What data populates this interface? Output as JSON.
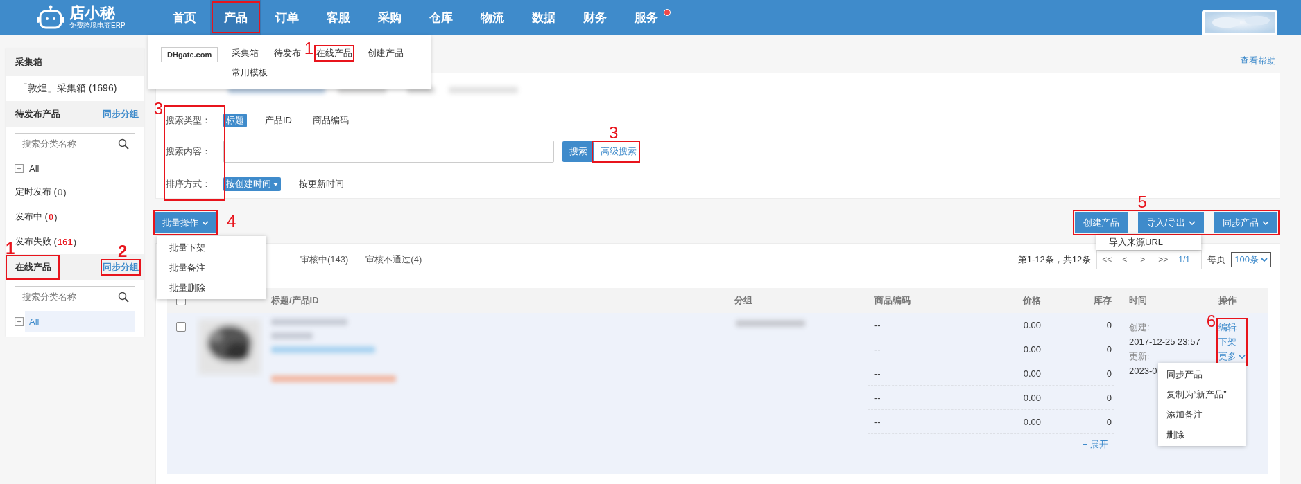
{
  "header": {
    "logo": {
      "name": "店小秘",
      "tagline": "免费跨境电商ERP"
    },
    "nav": [
      {
        "label": "首页",
        "selected": false,
        "boxed": false,
        "dot": false
      },
      {
        "label": "产品",
        "selected": true,
        "boxed": true,
        "dot": false
      },
      {
        "label": "订单",
        "selected": false,
        "boxed": false,
        "dot": false
      },
      {
        "label": "客服",
        "selected": false,
        "boxed": false,
        "dot": false
      },
      {
        "label": "采购",
        "selected": false,
        "boxed": false,
        "dot": false
      },
      {
        "label": "仓库",
        "selected": false,
        "boxed": false,
        "dot": false
      },
      {
        "label": "物流",
        "selected": false,
        "boxed": false,
        "dot": false
      },
      {
        "label": "数据",
        "selected": false,
        "boxed": false,
        "dot": false
      },
      {
        "label": "财务",
        "selected": false,
        "boxed": false,
        "dot": false
      },
      {
        "label": "服务",
        "selected": false,
        "boxed": false,
        "dot": true
      }
    ]
  },
  "product_menu": {
    "logo": "DHgate.com",
    "items": [
      {
        "label": "采集箱"
      },
      {
        "label": "待发布"
      },
      {
        "label": "在线产品",
        "boxed": true,
        "callout": "1"
      },
      {
        "label": "创建产品"
      },
      {
        "label": "常用模板"
      }
    ]
  },
  "sidebar": {
    "sections": [
      {
        "title": "采集箱",
        "entries": [
          "「敦煌」采集箱 (1696)"
        ]
      },
      {
        "title": "待发布产品",
        "action": "同步分组",
        "search_placeholder": "搜索分类名称",
        "tree": [
          {
            "label": "All",
            "selected": false
          }
        ],
        "items": [
          {
            "text": "定时发布 (**0**)",
            "alert": false
          },
          {
            "text": "发布中 (**0**)",
            "alert": true
          },
          {
            "text": "发布失败 (**161**)",
            "alert": true
          }
        ]
      },
      {
        "title": "在线产品",
        "title_boxed": true,
        "title_callout": "1",
        "action": "同步分组",
        "action_boxed": true,
        "action_callout": "2",
        "search_placeholder": "搜索分类名称",
        "tree": [
          {
            "label": "All",
            "selected": true
          }
        ]
      }
    ]
  },
  "help": "查看帮助",
  "filters": {
    "labels_boxed": true,
    "labels_callout": "3",
    "search_type": {
      "label": "搜索类型：",
      "options": [
        {
          "label": "标题",
          "selected": true
        },
        {
          "label": "产品ID",
          "selected": false
        },
        {
          "label": "商品编码",
          "selected": false
        }
      ]
    },
    "search_content": {
      "label": "搜索内容：",
      "button": "搜索",
      "advanced": "高级搜索",
      "advanced_boxed": true,
      "advanced_callout": "3"
    },
    "sort": {
      "label": "排序方式：",
      "options": [
        {
          "label": "按创建时间",
          "selected": true
        },
        {
          "label": "按更新时间",
          "selected": false
        }
      ]
    }
  },
  "batch": {
    "label": "批量操作",
    "boxed": true,
    "callout": "4",
    "open": true,
    "menu": [
      "批量下架",
      "批量备注",
      "批量删除"
    ]
  },
  "toolbar": {
    "boxed": true,
    "callout": "5",
    "buttons": [
      {
        "label": "创建产品",
        "kind": "plain"
      },
      {
        "label": "导入/导出",
        "kind": "dropdown",
        "open": true,
        "menu": [
          "导入来源URL"
        ]
      },
      {
        "label": "同步产品",
        "kind": "dropdown"
      }
    ]
  },
  "tabs": [
    {
      "label": "审核中(143)",
      "selected": false
    },
    {
      "label": "审核不通过(4)",
      "selected": false
    }
  ],
  "pagination": {
    "summary": "第1-12条，共12条",
    "buttons": [
      "<<",
      "<",
      ">",
      ">>"
    ],
    "page": "1/1",
    "per_page_label": "每页",
    "per_page": "100条"
  },
  "table": {
    "select_all": false,
    "columns": [
      "标题/产品ID",
      "分组",
      "商品编码",
      "价格",
      "库存",
      "时间",
      "操作"
    ],
    "rows": [
      {
        "checked": false,
        "variants": [
          {
            "code": "--",
            "price": "0.00",
            "stock": "0"
          },
          {
            "code": "--",
            "price": "0.00",
            "stock": "0"
          },
          {
            "code": "--",
            "price": "0.00",
            "stock": "0"
          },
          {
            "code": "--",
            "price": "0.00",
            "stock": "0"
          },
          {
            "code": "--",
            "price": "0.00",
            "stock": "0"
          }
        ],
        "expand": "+ 展开",
        "created_label": "创建:",
        "created": "2017-12-25 23:57",
        "updated_label": "更新:",
        "updated": "2023-0",
        "actions": {
          "boxed": true,
          "callout": "6",
          "links": [
            "编辑",
            "下架"
          ],
          "more": "更多",
          "more_open": true,
          "more_menu": [
            "同步产品",
            "复制为“新产品”",
            "添加备注",
            "删除"
          ]
        }
      }
    ]
  }
}
